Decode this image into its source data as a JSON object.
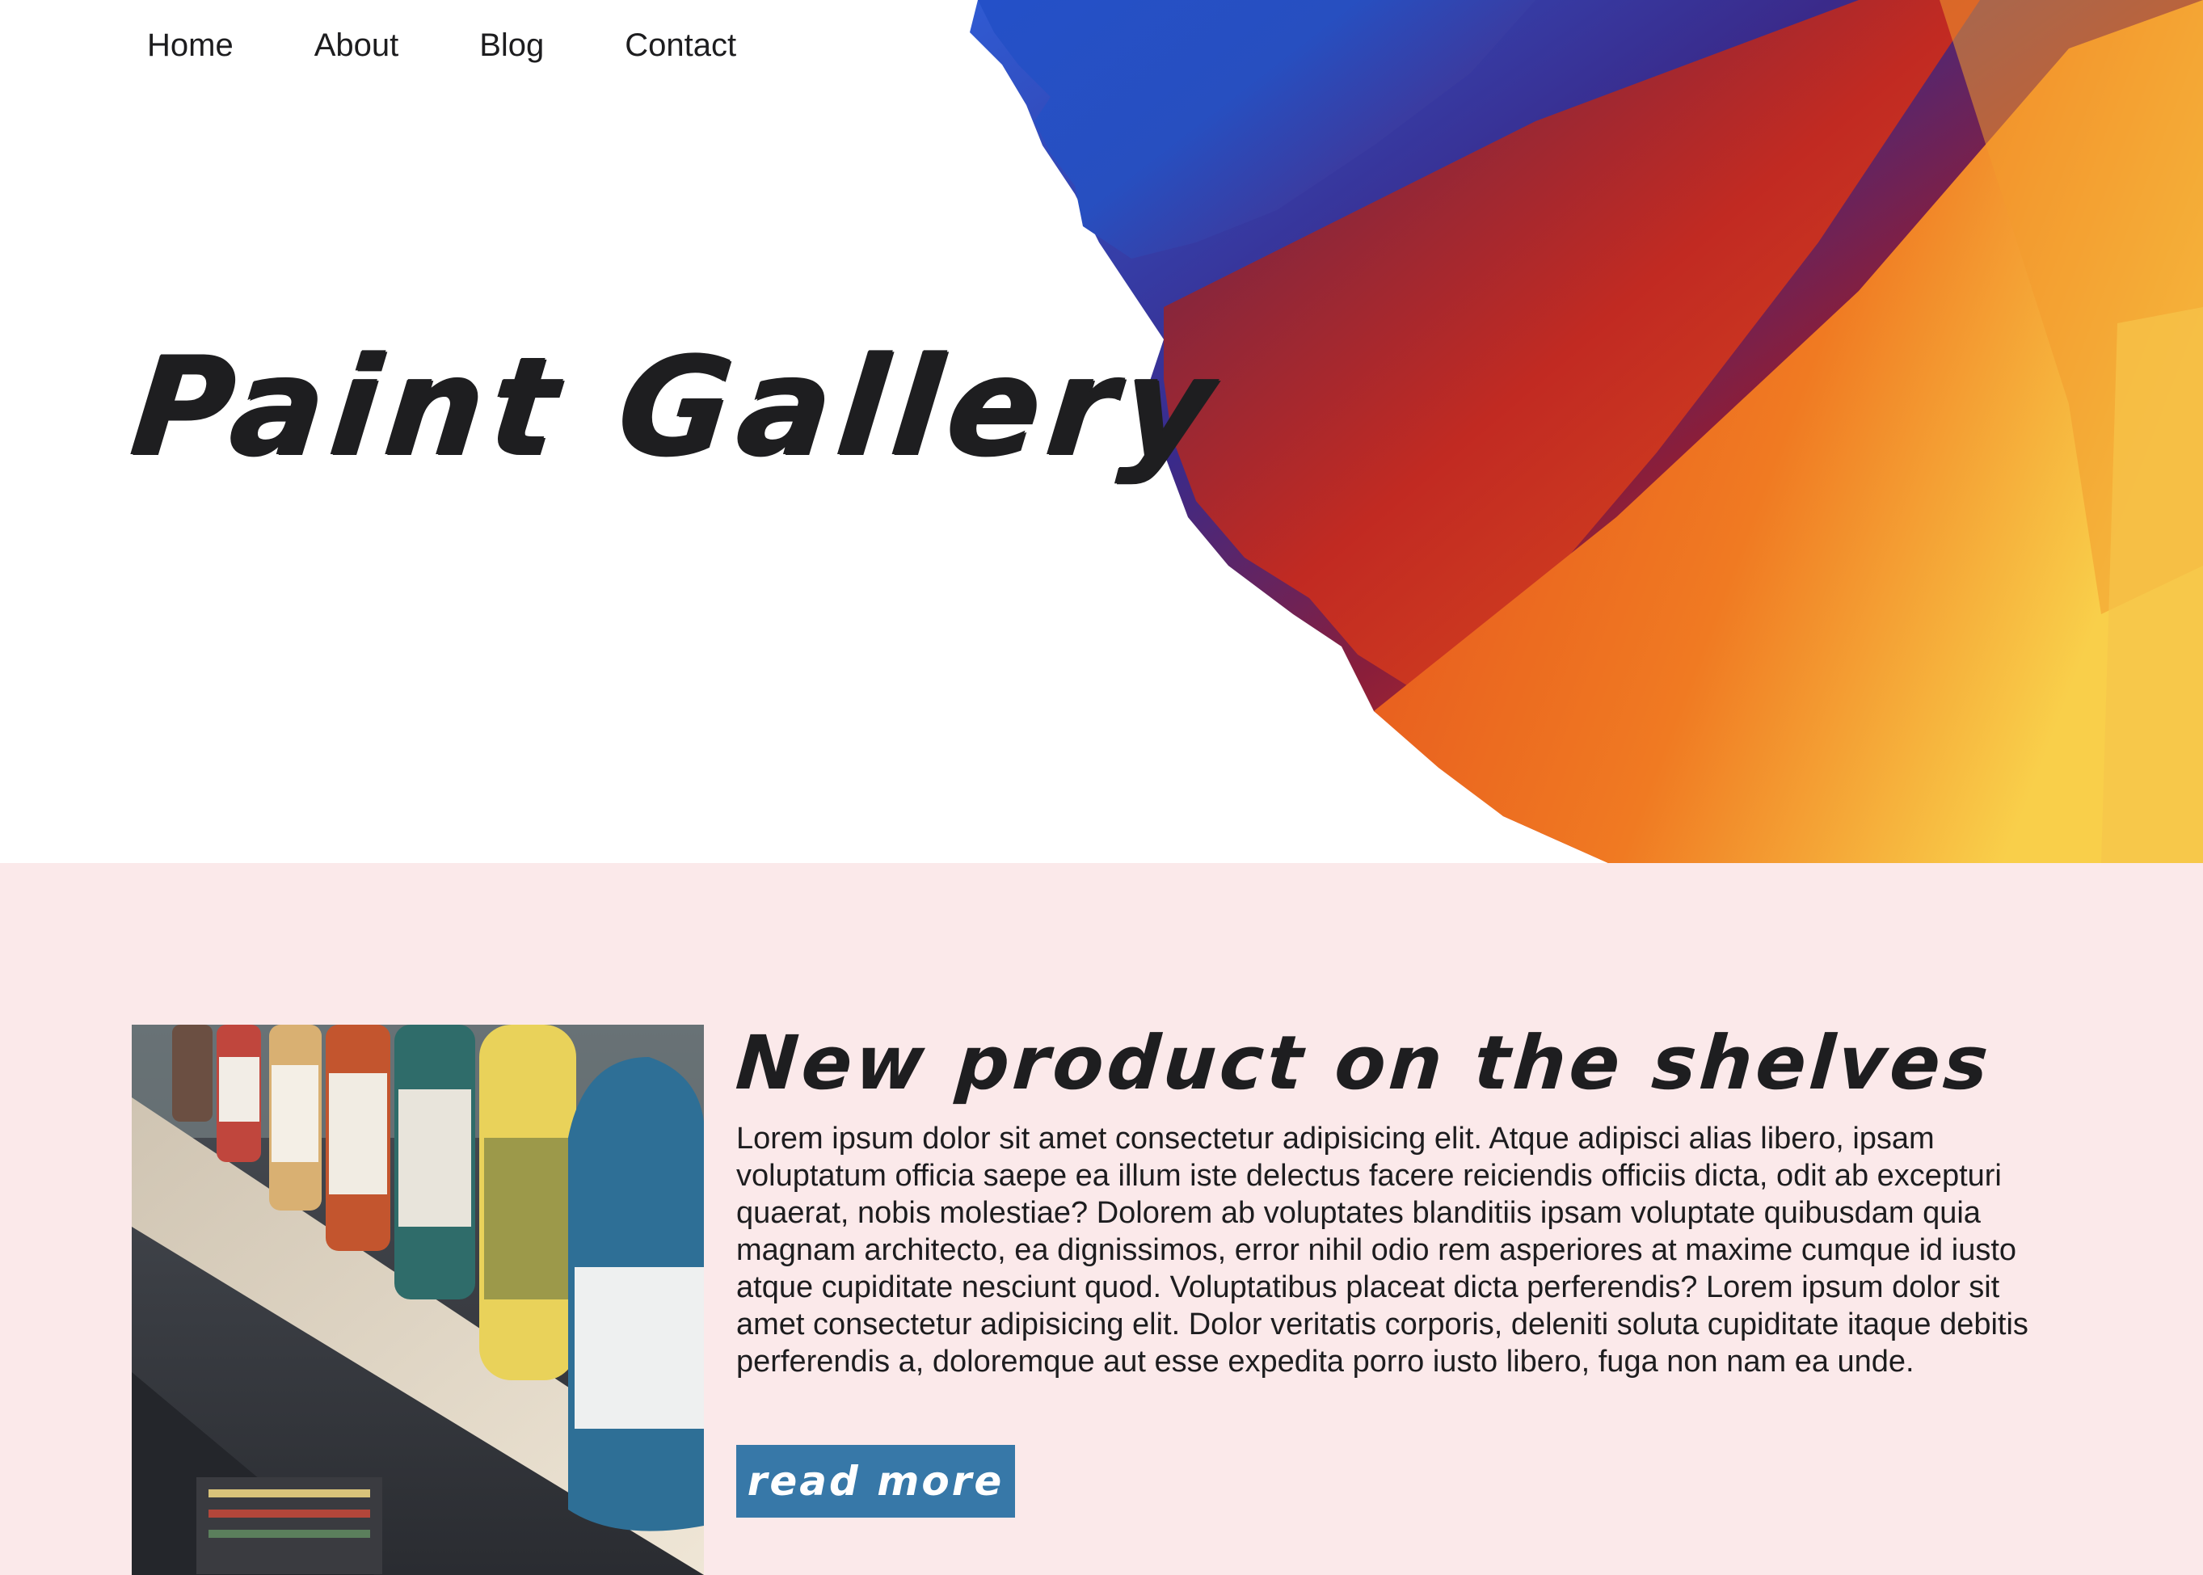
{
  "nav": {
    "items": [
      {
        "label": "Home"
      },
      {
        "label": "About"
      },
      {
        "label": "Blog"
      },
      {
        "label": "Contact"
      }
    ]
  },
  "hero": {
    "title": "Paint Gallery",
    "art": "paint-brush-strokes-blue-purple-red-orange-yellow"
  },
  "product": {
    "image": "paint-bottles-on-shelf-photo",
    "heading": "New product on the shelves",
    "body": "Lorem ipsum dolor sit amet consectetur adipisicing elit. Atque adipisci alias libero, ipsam voluptatum officia saepe ea illum iste delectus facere reiciendis officiis dicta, odit ab excepturi quaerat, nobis molestiae? Dolorem ab voluptates blanditiis ipsam voluptate quibusdam quia magnam architecto, ea dignissimos, error nihil odio rem asperiores at maxime cumque id iusto atque cupiditate nesciunt quod. Voluptatibus placeat dicta perferendis? Lorem ipsum dolor sit amet consectetur adipisicing elit. Dolor veritatis corporis, deleniti soluta cupiditate itaque debitis perferendis a, doloremque aut esse expedita porro iusto libero, fuga non nam ea unde.",
    "button_label": "read more"
  },
  "colors": {
    "section_background": "#fbe9ea",
    "button_background": "#3778a8",
    "text": "#1d1d1f"
  }
}
